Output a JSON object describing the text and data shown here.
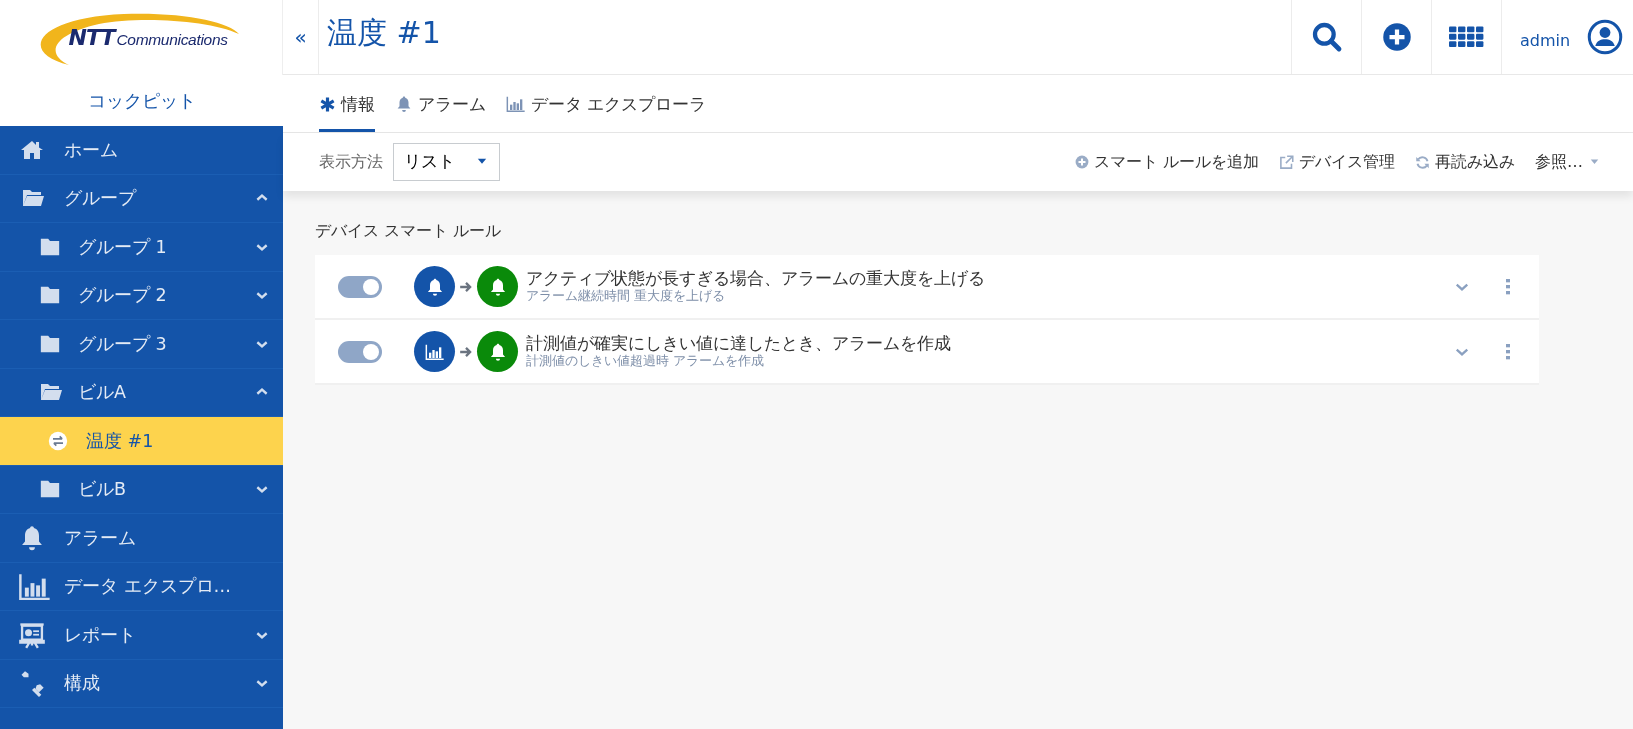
{
  "logo": {
    "brand": "NTT",
    "name": "Communications"
  },
  "app_title": "コックピット",
  "sidebar": {
    "items": [
      {
        "label": "ホーム",
        "kind": "home",
        "selected": false
      },
      {
        "label": "グループ",
        "kind": "folder",
        "selected": false,
        "expanded": true,
        "children": [
          {
            "label": "グループ 1",
            "kind": "folder",
            "selected": false,
            "expanded": false
          },
          {
            "label": "グループ 2",
            "kind": "folder",
            "selected": false,
            "expanded": false
          },
          {
            "label": "グループ 3",
            "kind": "folder",
            "selected": false,
            "expanded": false
          },
          {
            "label": "ビルA",
            "kind": "folder",
            "selected": false,
            "expanded": true,
            "children": [
              {
                "label": "温度 #1",
                "kind": "device",
                "selected": true
              }
            ]
          },
          {
            "label": "ビルB",
            "kind": "folder",
            "selected": false,
            "expanded": false
          }
        ]
      },
      {
        "label": "アラーム",
        "kind": "alarm",
        "selected": false
      },
      {
        "label": "データ エクスプロ…",
        "kind": "chart",
        "selected": false
      },
      {
        "label": "レポート",
        "kind": "report",
        "selected": false,
        "expanded": false
      },
      {
        "label": "構成",
        "kind": "tools",
        "selected": false,
        "expanded": false
      }
    ]
  },
  "header": {
    "collapse": "«",
    "title": "温度 #1",
    "user": "admin"
  },
  "tabs": [
    {
      "label": "情報",
      "kind": "info",
      "selected": true
    },
    {
      "label": "アラーム",
      "kind": "alarm",
      "selected": false
    },
    {
      "label": "データ エクスプローラ",
      "kind": "chart",
      "selected": false
    }
  ],
  "toolbar": {
    "view_label": "表示方法",
    "view_value": "リスト",
    "actions": [
      {
        "label": "スマート ルールを追加",
        "kind": "add"
      },
      {
        "label": "デバイス管理",
        "kind": "external"
      },
      {
        "label": "再読み込み",
        "kind": "reload"
      },
      {
        "label": "参照…",
        "kind": "menu"
      }
    ]
  },
  "section_title": "デバイス スマート ルール",
  "rules": [
    {
      "on": true,
      "kind": "alarm",
      "title": "アクティブ状態が長すぎる場合、アラームの重大度を上げる",
      "subtitle": "アラーム継続時間 重大度を上げる"
    },
    {
      "on": true,
      "kind": "measurement",
      "title": "計測値が確実にしきい値に達したとき、アラームを作成",
      "subtitle": "計測値のしきい値超過時 アラームを作成"
    }
  ]
}
